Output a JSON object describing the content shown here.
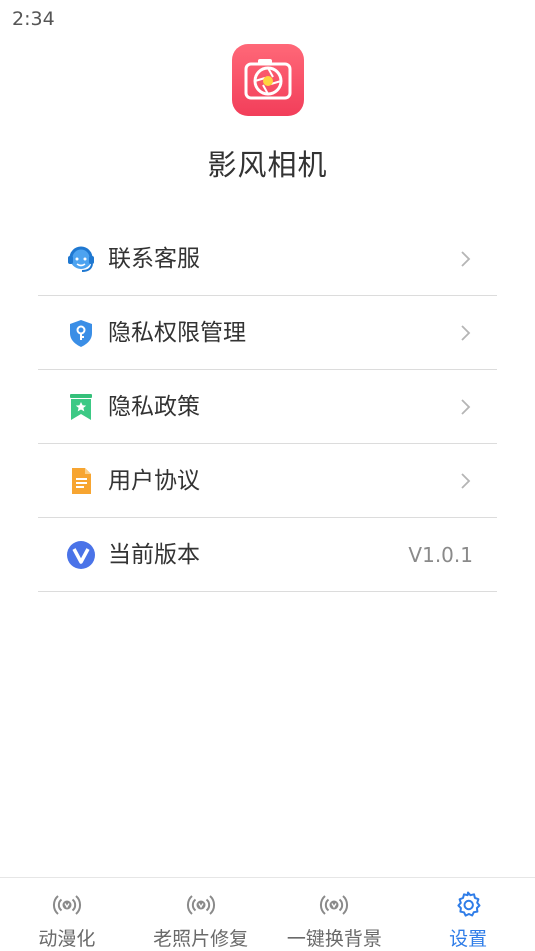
{
  "status_bar": {
    "time": "2:34"
  },
  "app": {
    "name": "影风相机",
    "logo_icon": "camera-aperture-icon",
    "logo_color": "#f24a60"
  },
  "menu": {
    "items": [
      {
        "label": "联系客服",
        "icon": "customer-service-icon",
        "action": "chevron"
      },
      {
        "label": "隐私权限管理",
        "icon": "privacy-shield-icon",
        "action": "chevron"
      },
      {
        "label": "隐私政策",
        "icon": "bookmark-star-icon",
        "action": "chevron"
      },
      {
        "label": "用户协议",
        "icon": "document-icon",
        "action": "chevron"
      },
      {
        "label": "当前版本",
        "icon": "version-v-icon",
        "value": "V1.0.1"
      }
    ]
  },
  "tabs": [
    {
      "label": "动漫化",
      "icon": "broadcast-icon",
      "active": false
    },
    {
      "label": "老照片修复",
      "icon": "broadcast-icon",
      "active": false
    },
    {
      "label": "一键换背景",
      "icon": "broadcast-icon",
      "active": false
    },
    {
      "label": "设置",
      "icon": "gear-icon",
      "active": true
    }
  ],
  "colors": {
    "accent": "#2f7de8",
    "inactive_tab": "#6a6a6a",
    "divider": "#dcdcdc"
  }
}
